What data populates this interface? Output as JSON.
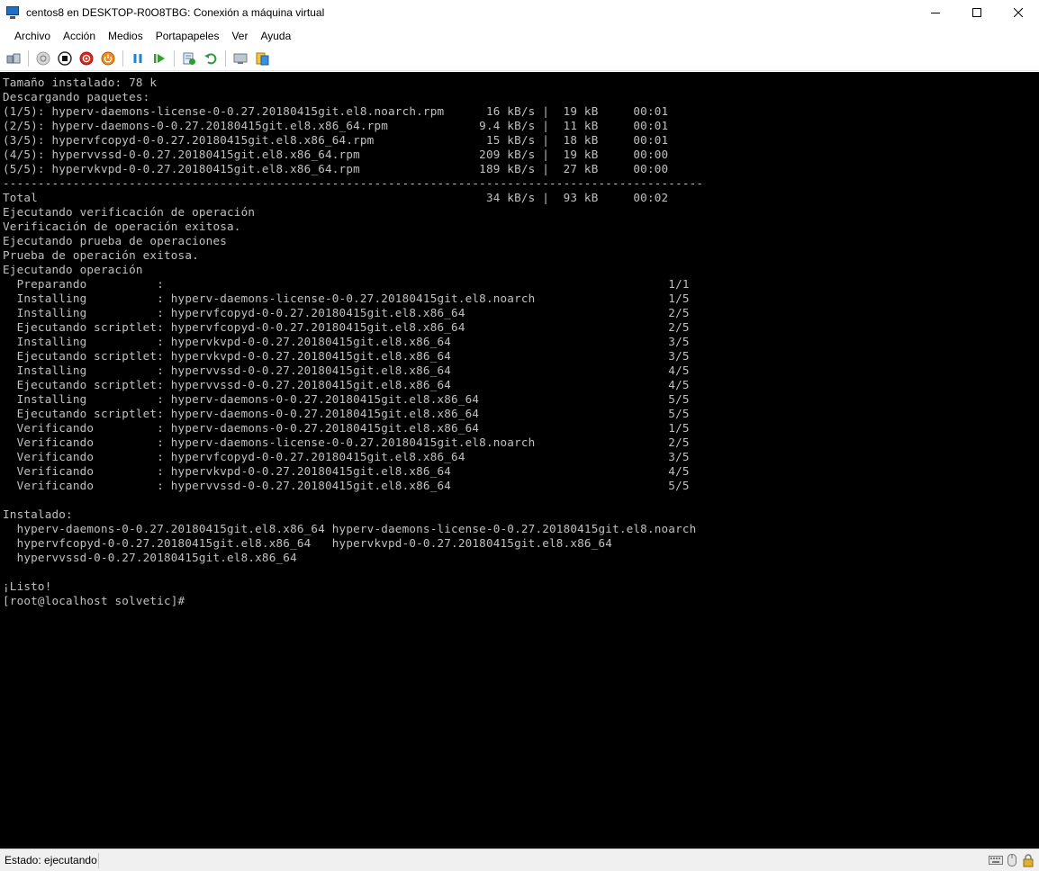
{
  "window": {
    "title": "centos8 en DESKTOP-R0O8TBG: Conexión a máquina virtual"
  },
  "menu": {
    "items": [
      "Archivo",
      "Acción",
      "Medios",
      "Portapapeles",
      "Ver",
      "Ayuda"
    ]
  },
  "toolbar": {
    "icons": [
      "ctrl-alt-del-icon",
      "start-icon",
      "turn-off-icon",
      "shut-down-icon",
      "save-state-icon",
      "pause-icon",
      "resume-icon",
      "checkpoint-icon",
      "revert-icon",
      "enhanced-session-icon",
      "share-icon"
    ]
  },
  "console": {
    "lines": [
      "Tamaño instalado: 78 k",
      "Descargando paquetes:",
      "(1/5): hyperv-daemons-license-0-0.27.20180415git.el8.noarch.rpm      16 kB/s |  19 kB     00:01",
      "(2/5): hyperv-daemons-0-0.27.20180415git.el8.x86_64.rpm             9.4 kB/s |  11 kB     00:01",
      "(3/5): hypervfcopyd-0-0.27.20180415git.el8.x86_64.rpm                15 kB/s |  18 kB     00:01",
      "(4/5): hypervvssd-0-0.27.20180415git.el8.x86_64.rpm                 209 kB/s |  19 kB     00:00",
      "(5/5): hypervkvpd-0-0.27.20180415git.el8.x86_64.rpm                 189 kB/s |  27 kB     00:00",
      "----------------------------------------------------------------------------------------------------",
      "Total                                                                34 kB/s |  93 kB     00:02",
      "Ejecutando verificación de operación",
      "Verificación de operación exitosa.",
      "Ejecutando prueba de operaciones",
      "Prueba de operación exitosa.",
      "Ejecutando operación",
      "  Preparando          :                                                                        1/1",
      "  Installing          : hyperv-daemons-license-0-0.27.20180415git.el8.noarch                   1/5",
      "  Installing          : hypervfcopyd-0-0.27.20180415git.el8.x86_64                             2/5",
      "  Ejecutando scriptlet: hypervfcopyd-0-0.27.20180415git.el8.x86_64                             2/5",
      "  Installing          : hypervkvpd-0-0.27.20180415git.el8.x86_64                               3/5",
      "  Ejecutando scriptlet: hypervkvpd-0-0.27.20180415git.el8.x86_64                               3/5",
      "  Installing          : hypervvssd-0-0.27.20180415git.el8.x86_64                               4/5",
      "  Ejecutando scriptlet: hypervvssd-0-0.27.20180415git.el8.x86_64                               4/5",
      "  Installing          : hyperv-daemons-0-0.27.20180415git.el8.x86_64                           5/5",
      "  Ejecutando scriptlet: hyperv-daemons-0-0.27.20180415git.el8.x86_64                           5/5",
      "  Verificando         : hyperv-daemons-0-0.27.20180415git.el8.x86_64                           1/5",
      "  Verificando         : hyperv-daemons-license-0-0.27.20180415git.el8.noarch                   2/5",
      "  Verificando         : hypervfcopyd-0-0.27.20180415git.el8.x86_64                             3/5",
      "  Verificando         : hypervkvpd-0-0.27.20180415git.el8.x86_64                               4/5",
      "  Verificando         : hypervvssd-0-0.27.20180415git.el8.x86_64                               5/5",
      "",
      "Instalado:",
      "  hyperv-daemons-0-0.27.20180415git.el8.x86_64 hyperv-daemons-license-0-0.27.20180415git.el8.noarch",
      "  hypervfcopyd-0-0.27.20180415git.el8.x86_64   hypervkvpd-0-0.27.20180415git.el8.x86_64",
      "  hypervvssd-0-0.27.20180415git.el8.x86_64",
      "",
      "¡Listo!",
      "[root@localhost solvetic]#"
    ]
  },
  "status": {
    "text": "Estado: ejecutando"
  }
}
